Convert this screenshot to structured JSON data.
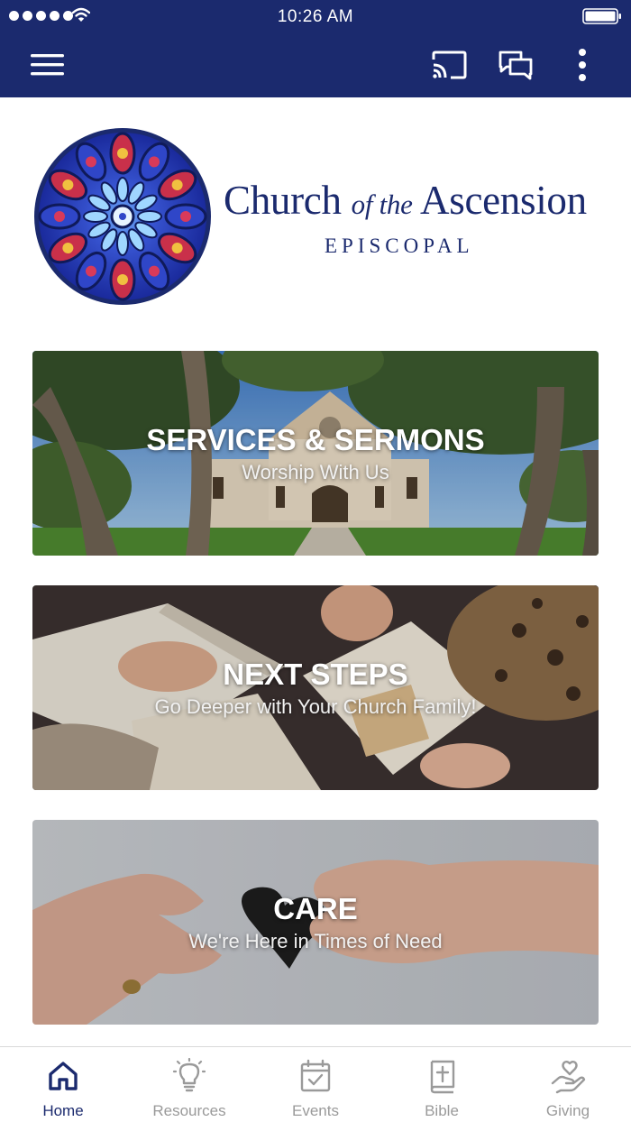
{
  "status_bar": {
    "time": "10:26 AM"
  },
  "header": {
    "menu_icon": "hamburger-menu-icon",
    "actions": [
      "cast-icon",
      "chat-icon",
      "more-vertical-icon"
    ],
    "background_color": "#1b2a6e"
  },
  "logo": {
    "name_part1": "Church ",
    "name_of_the": "of the",
    "name_part2": " Ascension",
    "subtitle": "EPISCOPAL",
    "color": "#1b2a6e"
  },
  "cards": [
    {
      "title": "SERVICES & SERMONS",
      "subtitle": "Worship With Us"
    },
    {
      "title": "NEXT STEPS",
      "subtitle": "Go Deeper with Your Church Family!"
    },
    {
      "title": "CARE",
      "subtitle": "We're Here in Times of Need"
    }
  ],
  "tabs": [
    {
      "label": "Home",
      "icon": "home-icon",
      "active": true
    },
    {
      "label": "Resources",
      "icon": "lightbulb-icon",
      "active": false
    },
    {
      "label": "Events",
      "icon": "calendar-check-icon",
      "active": false
    },
    {
      "label": "Bible",
      "icon": "bible-icon",
      "active": false
    },
    {
      "label": "Giving",
      "icon": "heart-hand-icon",
      "active": false
    }
  ],
  "colors": {
    "accent": "#1b2a6e",
    "inactive": "#9a9a9a"
  }
}
